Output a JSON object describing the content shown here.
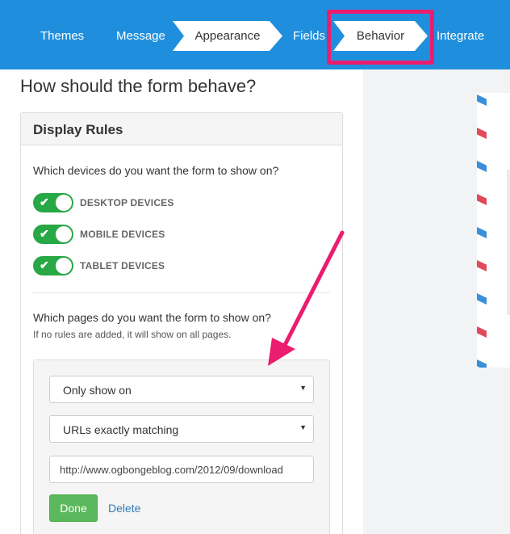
{
  "nav": {
    "themes": "Themes",
    "message": "Message",
    "appearance": "Appearance",
    "fields": "Fields",
    "behavior": "Behavior",
    "integrate": "Integrate",
    "bar_color": "#1f8fdd",
    "highlight_color": "#ea1d6f"
  },
  "page": {
    "title": "How should the form behave?"
  },
  "display_rules": {
    "panel_title": "Display Rules",
    "devices_question": "Which devices do you want the form to show on?",
    "devices": [
      {
        "label": "DESKTOP DEVICES",
        "enabled": true
      },
      {
        "label": "MOBILE DEVICES",
        "enabled": true
      },
      {
        "label": "TABLET DEVICES",
        "enabled": true
      }
    ],
    "toggle_color": "#28a745",
    "pages_question": "Which pages do you want the form to show on?",
    "pages_hint": "If no rules are added, it will show on all pages.",
    "rule": {
      "show_select": "Only show on",
      "match_select": "URLs exactly matching",
      "url_value": "http://www.ogbongeblog.com/2012/09/download",
      "done_label": "Done",
      "delete_label": "Delete"
    }
  },
  "icons": {
    "toggle_check": "check-icon",
    "select_caret": "caret-down-icon",
    "annotation": "pointer-arrow"
  }
}
